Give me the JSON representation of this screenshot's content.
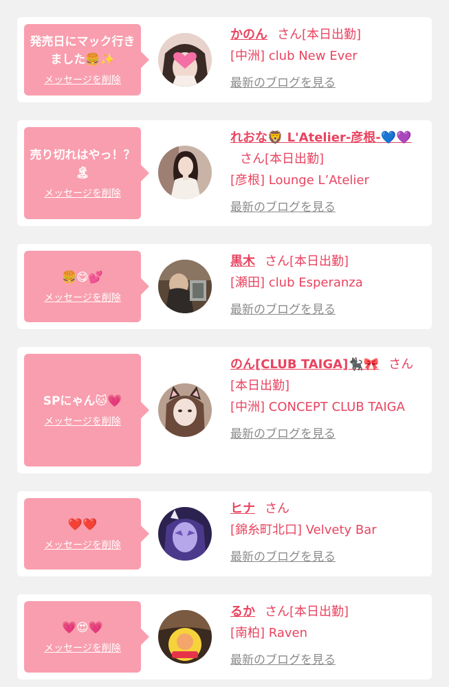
{
  "delete_label": "メッセージを削除",
  "blog_label": "最新のブログを見る",
  "honorific": "さん",
  "entries": [
    {
      "message": "発売日にマック行きました🍔✨",
      "name": "かのん",
      "status": "[本日出勤]",
      "shop": "[中洲] club New Ever",
      "avatar": "avatar-heart-sticker"
    },
    {
      "message": "売り切れはやっ！？🏝",
      "name": "れおな🦁 L'Atelier-彦根-💙💜",
      "status": "[本日出勤]",
      "shop": "[彦根] Lounge L’Atelier",
      "avatar": "avatar-woman-white-dress"
    },
    {
      "message": "🍔😋💕",
      "name": "黒木",
      "status": "[本日出勤]",
      "shop": "[瀬田] club Esperanza",
      "avatar": "avatar-brown-photo"
    },
    {
      "message": "SPにゃん🐱💗",
      "name": "のん[CLUB TAIGA]🐈‍⬛🎀",
      "status": "[本日出勤]",
      "shop": "[中洲] CONCEPT CLUB TAIGA",
      "avatar": "avatar-cat-ears"
    },
    {
      "message": "❤️❤️",
      "name": "ヒナ",
      "status": "",
      "shop": "[錦糸町北口] Velvety Bar",
      "avatar": "avatar-purple-mask"
    },
    {
      "message": "💗😍💗",
      "name": "るか",
      "status": "[本日出勤]",
      "shop": "[南柏] Raven",
      "avatar": "avatar-yellow-sticker"
    }
  ],
  "colors": {
    "accent": "#e8435f",
    "bubble": "#f99eae",
    "blog_link": "#8b8b8b",
    "background": "#f2f1f1"
  }
}
